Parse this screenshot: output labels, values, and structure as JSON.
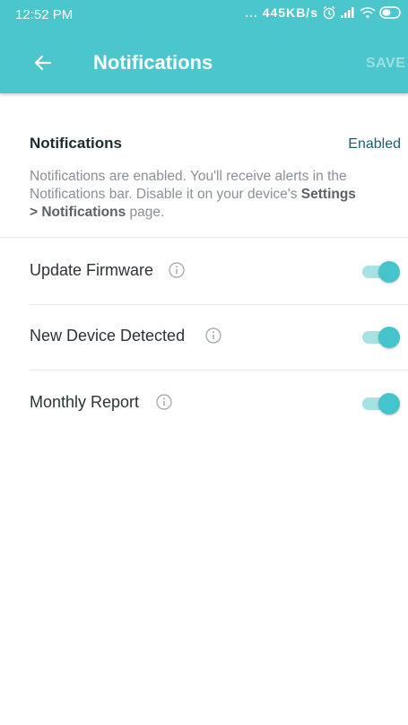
{
  "status_bar": {
    "time": "12:52 PM",
    "network_speed": "... 445KB/s",
    "icons": [
      "alarm-icon",
      "signal-icon",
      "wifi-icon",
      "battery-icon"
    ]
  },
  "app_bar": {
    "back_icon": "arrow-left-icon",
    "title": "Notifications",
    "save_label": "SAVE"
  },
  "notifications": {
    "label": "Notifications",
    "state": "Enabled",
    "description_prefix": "Notifications are enabled. You'll receive alerts in the Notifications bar. Disable it on your device's ",
    "description_settings": "Settings",
    "description_separator": "> Notifications",
    "description_suffix": " page."
  },
  "toggles": [
    {
      "label": "Update Firmware",
      "enabled": true
    },
    {
      "label": "New Device Detected",
      "enabled": true
    },
    {
      "label": "Monthly Report",
      "enabled": true
    }
  ],
  "colors": {
    "accent": "#4cc6cd",
    "toggle_on": "#46c4cc",
    "toggle_track": "#a6e1e4",
    "enabled_text": "#1d5d6e"
  }
}
